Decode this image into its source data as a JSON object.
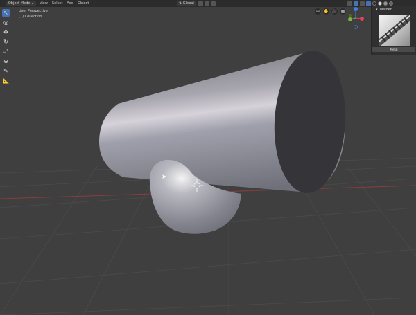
{
  "header": {
    "editor_icon": "⌖",
    "mode": "Object Mode",
    "menus": [
      "View",
      "Select",
      "Add",
      "Object"
    ],
    "transform_orientation": "Global"
  },
  "toolbar": {
    "tools": [
      {
        "name": "select-icon",
        "glyph": "↖"
      },
      {
        "name": "cursor-icon",
        "glyph": "◎"
      },
      {
        "name": "move-icon",
        "glyph": "✥"
      },
      {
        "name": "rotate-icon",
        "glyph": "↻"
      },
      {
        "name": "scale-icon",
        "glyph": "⤢"
      },
      {
        "name": "transform-icon",
        "glyph": "⊕"
      },
      {
        "name": "annotate-icon",
        "glyph": "✎"
      },
      {
        "name": "measure-icon",
        "glyph": "📐"
      }
    ]
  },
  "viewport": {
    "view_name": "User Perspective",
    "collection": "(1) Collection"
  },
  "nav": {
    "buttons": [
      "⊕",
      "✋",
      "🎥",
      "▦"
    ]
  },
  "panel": {
    "title": "Weider",
    "preview_button": "Metal"
  },
  "colors": {
    "accent": "#4772b3",
    "background": "#3f3f3f",
    "header": "#2c2c2c",
    "gizmo_x": "#e0445a",
    "gizmo_y": "#7fb43a",
    "gizmo_z": "#3c82ea"
  }
}
